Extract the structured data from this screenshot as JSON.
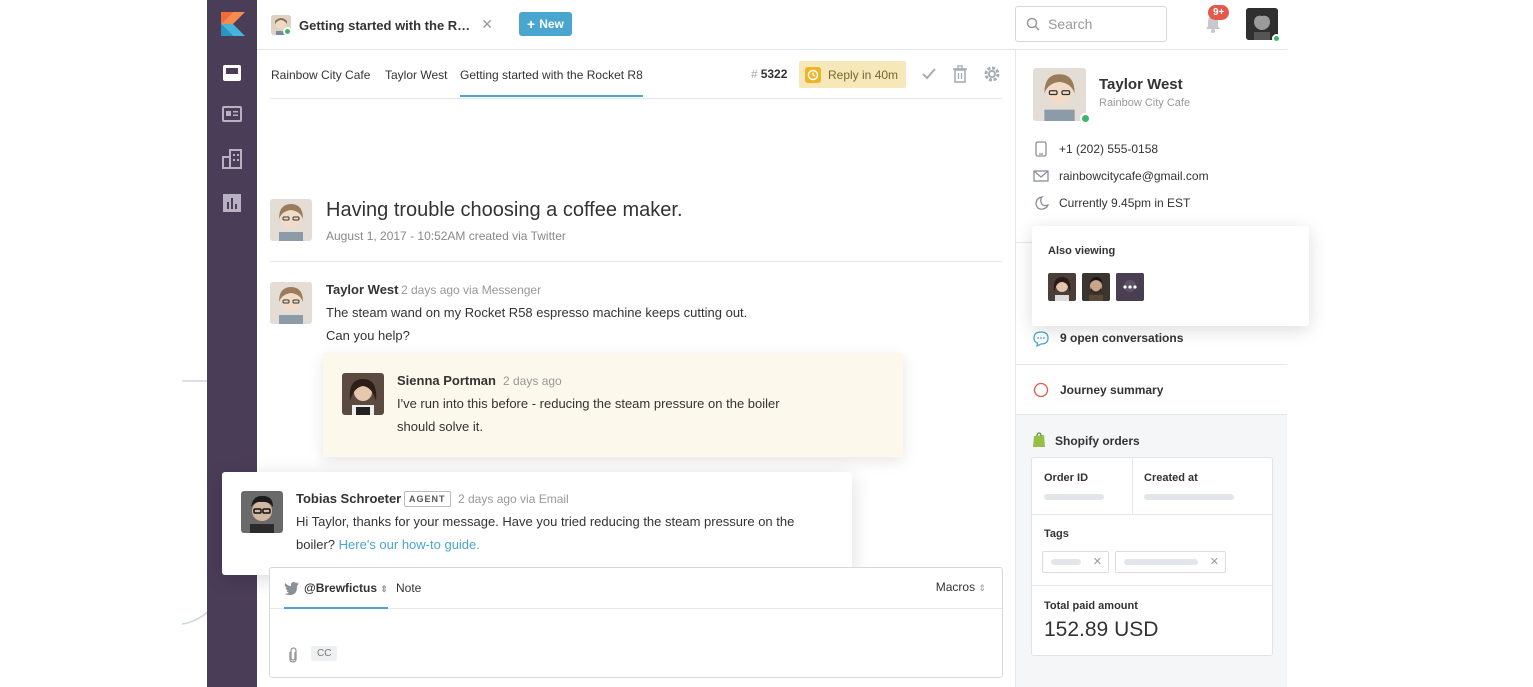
{
  "tabs": {
    "ticket_title": "Getting started with the Rocket R8",
    "new_label": "New"
  },
  "search": {
    "placeholder": "Search"
  },
  "notifications": {
    "badge": "9+"
  },
  "breadcrumbs": [
    "Rainbow City Cafe",
    "Taylor West",
    "Getting started with the Rocket R8"
  ],
  "ticket": {
    "hash": "#",
    "number": "5322",
    "reply_due": "Reply in 40m"
  },
  "conversation": {
    "subject": "Having trouble choosing a coffee maker.",
    "subject_meta": "August 1, 2017 - 10:52AM created via Twitter",
    "messages": [
      {
        "name": "Taylor West",
        "time": "2 days ago via Messenger",
        "line1": "The steam wand on my Rocket R58 espresso machine keeps cutting out.",
        "line2": "Can you help?"
      },
      {
        "name": "Sienna Portman",
        "time": "2 days ago",
        "line1": "I've run into this before - reducing the steam pressure on the boiler",
        "line2": "should solve it."
      },
      {
        "name": "Tobias Schroeter",
        "tag": "AGENT",
        "time": "2 days ago via Email",
        "line1": "Hi Taylor, thanks for your message. Have you tried reducing the steam pressure on the",
        "line2": "boiler?",
        "link": "Here's our how-to guide."
      }
    ]
  },
  "composer": {
    "channel": "@Brewfictus",
    "note": "Note",
    "macros": "Macros",
    "cc": "CC"
  },
  "customer": {
    "name": "Taylor West",
    "company": "Rainbow City Cafe",
    "phone": "+1 (202) 555-0158",
    "email": "rainbowcitycafe@gmail.com",
    "local_time": "Currently 9.45pm in EST"
  },
  "also_viewing": {
    "label": "Also viewing"
  },
  "sections": {
    "open_conversations": "9 open conversations",
    "journey": "Journey summary",
    "shopify": "Shopify orders"
  },
  "orders": {
    "order_id_label": "Order ID",
    "created_at_label": "Created at",
    "tags_label": "Tags",
    "total_label": "Total paid amount",
    "total_value": "152.89 USD"
  },
  "colors": {
    "sidebar": "#4a3d58",
    "accent": "#4ba6cf",
    "badge": "#e5584a",
    "online": "#3fb56b",
    "reply_pill": "#f6e8b8",
    "sienna_card": "#fcf8ec"
  }
}
